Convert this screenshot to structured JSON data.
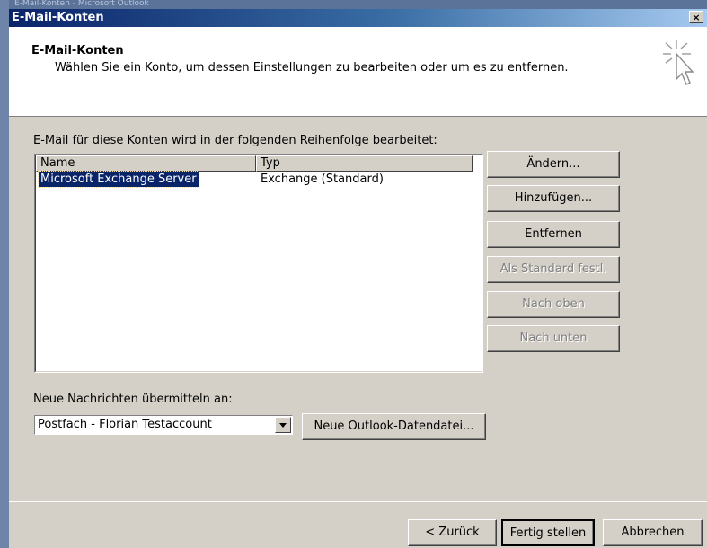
{
  "background": {
    "caption": "E-Mail-Konten - Microsoft Outlook"
  },
  "window": {
    "title": "E-Mail-Konten",
    "close_glyph": "×"
  },
  "header": {
    "title": "E-Mail-Konten",
    "description": "Wählen Sie ein Konto, um dessen Einstellungen zu bearbeiten oder um es zu entfernen.",
    "icon": "wizard-cursor-icon"
  },
  "accounts": {
    "caption": "E-Mail für diese Konten wird in der folgenden Reihenfolge bearbeitet:",
    "columns": [
      "Name",
      "Typ"
    ],
    "rows": [
      {
        "name": "Microsoft Exchange Server",
        "type": "Exchange (Standard)",
        "selected": true
      }
    ]
  },
  "side_buttons": {
    "change": "Ändern...",
    "add": "Hinzufügen...",
    "remove": "Entfernen",
    "set_default": "Als Standard festl.",
    "move_up": "Nach oben",
    "move_down": "Nach unten"
  },
  "delivery": {
    "label": "Neue Nachrichten übermitteln an:",
    "selected": "Postfach - Florian Testaccount",
    "new_data_file": "Neue Outlook-Datendatei..."
  },
  "footer": {
    "back": "< Zurück",
    "finish": "Fertig stellen",
    "cancel": "Abbrechen"
  },
  "colors": {
    "titlebar_start": "#0a246a",
    "titlebar_end": "#a6caf0",
    "selection": "#0a246a",
    "dialog": "#d4d0c8"
  }
}
